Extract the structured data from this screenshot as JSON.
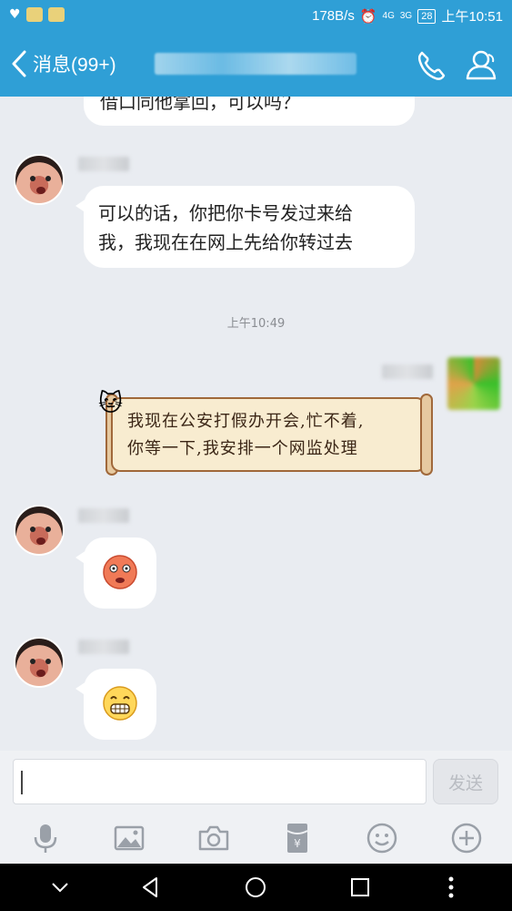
{
  "status_bar": {
    "net_speed": "178B/s",
    "net_4g": "4G",
    "net_3g": "3G",
    "battery": "28",
    "time": "上午10:51"
  },
  "header": {
    "back_label": "消息(99+)",
    "phone_icon": "phone-icon",
    "profile_icon": "profile-icon"
  },
  "chat": {
    "top_partial_text": "借口同他拿回，可以吗？",
    "messages": [
      {
        "text": "可以的话，你把你卡号发过来给\n我，我现在在网上先给你转过去"
      }
    ],
    "timestamp": "上午10:49",
    "my_message_line1": "我现在公安打假办开会,忙不着,",
    "my_message_line2": "你等一下,我安排一个网监处理",
    "emoji_1": "shocked-emoji",
    "emoji_2": "grin-emoji"
  },
  "input": {
    "value": "",
    "send_label": "发送"
  },
  "toolbar": [
    "microphone-icon",
    "image-icon",
    "camera-icon",
    "red-packet-icon",
    "emoji-icon",
    "plus-icon"
  ],
  "navbar": [
    "chevron-down-icon",
    "back-icon",
    "home-icon",
    "recents-icon",
    "more-icon"
  ],
  "colors": {
    "accent": "#2f9fd6",
    "chat_bg": "#e9ecf1"
  }
}
